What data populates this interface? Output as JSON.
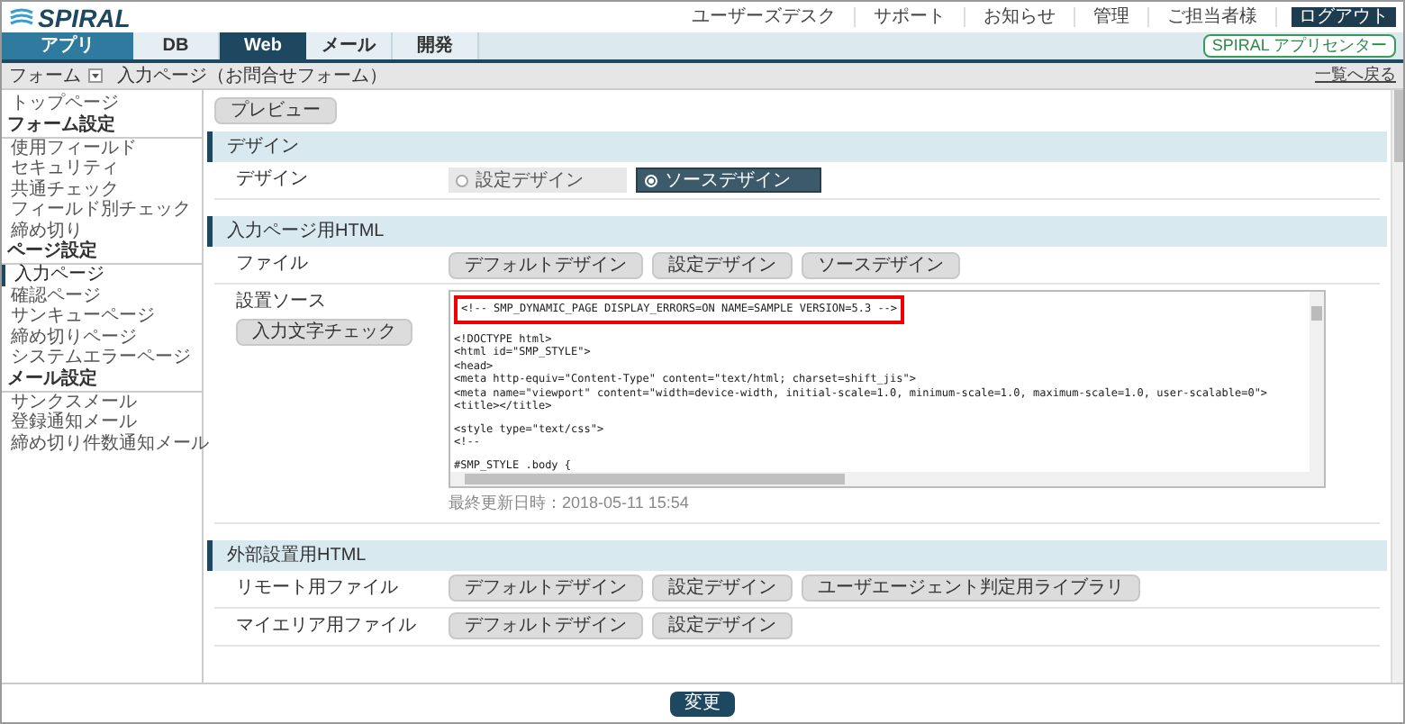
{
  "header": {
    "logo": "SPIRAL",
    "links": [
      "ユーザーズデスク",
      "サポート",
      "お知らせ",
      "管理",
      "ご担当者様"
    ],
    "logout": "ログアウト"
  },
  "tabs": [
    {
      "label": "アプリ",
      "selected": false,
      "kind": "app"
    },
    {
      "label": "DB",
      "selected": false,
      "kind": "normal"
    },
    {
      "label": "Web",
      "selected": true,
      "kind": "normal"
    },
    {
      "label": "メール",
      "selected": false,
      "kind": "normal"
    },
    {
      "label": "開発",
      "selected": false,
      "kind": "normal"
    }
  ],
  "app_center": "SPIRAL アプリセンター",
  "breadcrumb": {
    "menu": "フォーム",
    "current": "入力ページ（お問合せフォーム）",
    "back_link": "一覧へ戻る"
  },
  "sidebar": [
    {
      "label": "トップページ",
      "kind": "item",
      "selected": false
    },
    {
      "label": "フォーム設定",
      "kind": "heading"
    },
    {
      "label": "使用フィールド",
      "kind": "item",
      "selected": false
    },
    {
      "label": "セキュリティ",
      "kind": "item",
      "selected": false
    },
    {
      "label": "共通チェック",
      "kind": "item",
      "selected": false
    },
    {
      "label": "フィールド別チェック",
      "kind": "item",
      "selected": false
    },
    {
      "label": "締め切り",
      "kind": "item",
      "selected": false
    },
    {
      "label": "ページ設定",
      "kind": "heading"
    },
    {
      "label": "入力ページ",
      "kind": "item",
      "selected": true
    },
    {
      "label": "確認ページ",
      "kind": "item",
      "selected": false
    },
    {
      "label": "サンキューページ",
      "kind": "item",
      "selected": false
    },
    {
      "label": "締め切りページ",
      "kind": "item",
      "selected": false
    },
    {
      "label": "システムエラーページ",
      "kind": "item",
      "selected": false
    },
    {
      "label": "メール設定",
      "kind": "heading"
    },
    {
      "label": "サンクスメール",
      "kind": "item",
      "selected": false
    },
    {
      "label": "登録通知メール",
      "kind": "item",
      "selected": false
    },
    {
      "label": "締め切り件数通知メール",
      "kind": "item",
      "selected": false
    }
  ],
  "preview_button": "プレビュー",
  "design_section": {
    "title": "デザイン",
    "label": "デザイン",
    "options": [
      {
        "label": "設定デザイン",
        "selected": false
      },
      {
        "label": "ソースデザイン",
        "selected": true
      }
    ]
  },
  "html_section": {
    "title": "入力ページ用HTML",
    "file_label": "ファイル",
    "file_buttons": [
      "デフォルトデザイン",
      "設定デザイン",
      "ソースデザイン"
    ],
    "source_label": "設置ソース",
    "check_button": "入力文字チェック",
    "source_first_line": "<!-- SMP_DYNAMIC_PAGE DISPLAY_ERRORS=ON NAME=SAMPLE VERSION=5.3 -->",
    "source_blocks": [
      [
        "<!DOCTYPE html>",
        "<html id=\"SMP_STYLE\">",
        "<head>",
        "<meta http-equiv=\"Content-Type\" content=\"text/html; charset=shift_jis\">",
        "<meta name=\"viewport\" content=\"width=device-width, initial-scale=1.0, minimum-scale=1.0, maximum-scale=1.0, user-scalable=0\">",
        "<title></title>"
      ],
      [
        "<style type=\"text/css\">",
        "<!--"
      ],
      [
        "#SMP_STYLE .body {"
      ]
    ],
    "updated": "最終更新日時：2018-05-11 15:54"
  },
  "external_section": {
    "title": "外部設置用HTML",
    "rows": [
      {
        "label": "リモート用ファイル",
        "buttons": [
          "デフォルトデザイン",
          "設定デザイン",
          "ユーザエージェント判定用ライブラリ"
        ]
      },
      {
        "label": "マイエリア用ファイル",
        "buttons": [
          "デフォルトデザイン",
          "設定デザイン"
        ]
      }
    ]
  },
  "submit_button": "変更"
}
